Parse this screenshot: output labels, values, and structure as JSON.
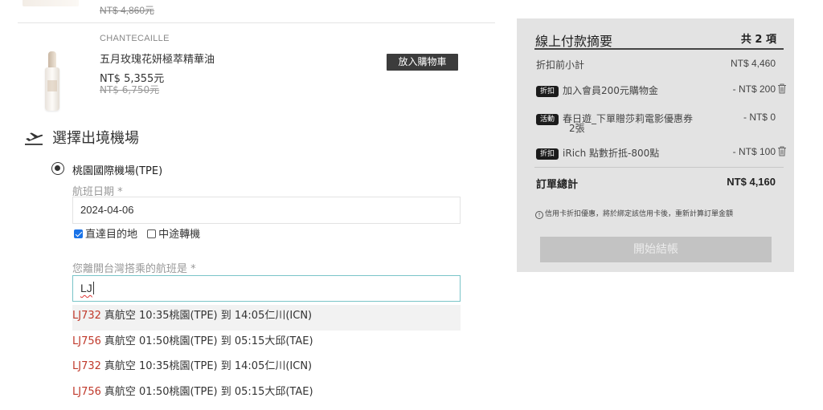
{
  "previous_item": {
    "old_price": "NT$ 4,860元"
  },
  "product": {
    "brand": "CHANTECAILLE",
    "name": "五月玫瑰花妍極萃精華油",
    "price": "NT$ 5,355元",
    "old_price": "NT$ 6,750元",
    "add_to_cart_label": "放入購物車"
  },
  "airport": {
    "title": "選擇出境機場",
    "icon": "airplane-departure-icon",
    "selected_option": "桃園國際機場(TPE)"
  },
  "flight_date": {
    "label": "航班日期 *",
    "value": "2024-04-06"
  },
  "flight_type": {
    "direct_label": "直達目的地",
    "direct_checked": true,
    "transit_label": "中途轉機",
    "transit_checked": false
  },
  "flight_no": {
    "label": "您離開台灣搭乘的航班是 *",
    "value": "LJ"
  },
  "suggestions": [
    {
      "code": "LJ732",
      "detail": "真航空 10:35桃園(TPE) 到 14:05仁川(ICN)"
    },
    {
      "code": "LJ756",
      "detail": "真航空 01:50桃園(TPE) 到 05:15大邱(TAE)"
    },
    {
      "code": "LJ732",
      "detail": "真航空 10:35桃園(TPE) 到 14:05仁川(ICN)"
    },
    {
      "code": "LJ756",
      "detail": "真航空 01:50桃園(TPE) 到 05:15大邱(TAE)"
    }
  ],
  "summary": {
    "title": "線上付款摘要",
    "count": "共 2 項",
    "subtotal_label": "折扣前小計",
    "subtotal_value": "NT$ 4,460",
    "discounts": [
      {
        "badge": "折扣",
        "label": "加入會員200元購物金",
        "value": "- NT$ 200",
        "removable": true
      },
      {
        "badge": "活動",
        "label": "春日遊_下單贈莎莉電影優惠券",
        "label_line2": "2張",
        "value": "- NT$ 0",
        "removable": false
      },
      {
        "badge": "折扣",
        "label": "iRich 點數折抵-800點",
        "value": "- NT$ 100",
        "removable": true
      }
    ],
    "total_label": "訂單總計",
    "total_value": "NT$ 4,160",
    "note": "信用卡折扣優惠，將於綁定該信用卡後，重新計算訂單金額",
    "checkout_label": "開始結帳",
    "colors": {
      "panel": "#e3e3e3",
      "button_disabled": "#c3c3c3",
      "flight_code": "#c0392b",
      "input_focus": "#79c4c8"
    }
  }
}
